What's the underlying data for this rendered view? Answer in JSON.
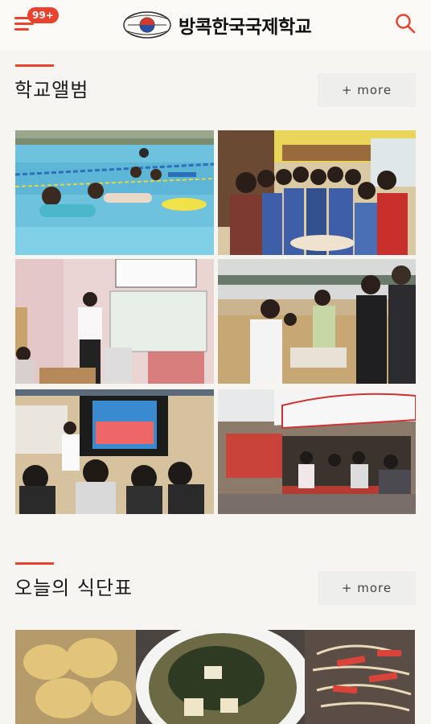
{
  "header": {
    "badge": "99+",
    "school_name": "방콕한국국제학교"
  },
  "album": {
    "title": "학교앨범",
    "more_label": "+ more",
    "photos": [
      {
        "name": "album-photo-swimming",
        "desc": "swimming lesson"
      },
      {
        "name": "album-photo-cooking",
        "desc": "cooking class group"
      },
      {
        "name": "album-photo-classroom",
        "desc": "teacher in classroom"
      },
      {
        "name": "album-photo-gym-activity",
        "desc": "gym activity"
      },
      {
        "name": "album-photo-presentation",
        "desc": "student presentation"
      },
      {
        "name": "album-photo-field-trip",
        "desc": "field trip tram"
      }
    ]
  },
  "meal": {
    "title": "오늘의 식단표",
    "more_label": "+ more"
  },
  "colors": {
    "accent": "#e8432f",
    "background": "#f6f5f1",
    "more_button_bg": "#eeeeec"
  }
}
